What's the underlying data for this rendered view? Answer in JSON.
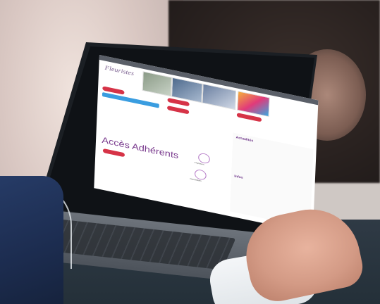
{
  "screen": {
    "site_logo_text": "Fleuristes",
    "main_heading": "Accès Adhérents",
    "sections": [
      {
        "label": "Phyteaum"
      },
      {
        "label": "Newsletters"
      }
    ],
    "right_panel": {
      "title_1": "Actualités",
      "title_2": "Infos"
    }
  },
  "colors": {
    "accent_red": "#d63347",
    "accent_purple": "#7a3b8e",
    "link_blue": "#3a9de0"
  }
}
